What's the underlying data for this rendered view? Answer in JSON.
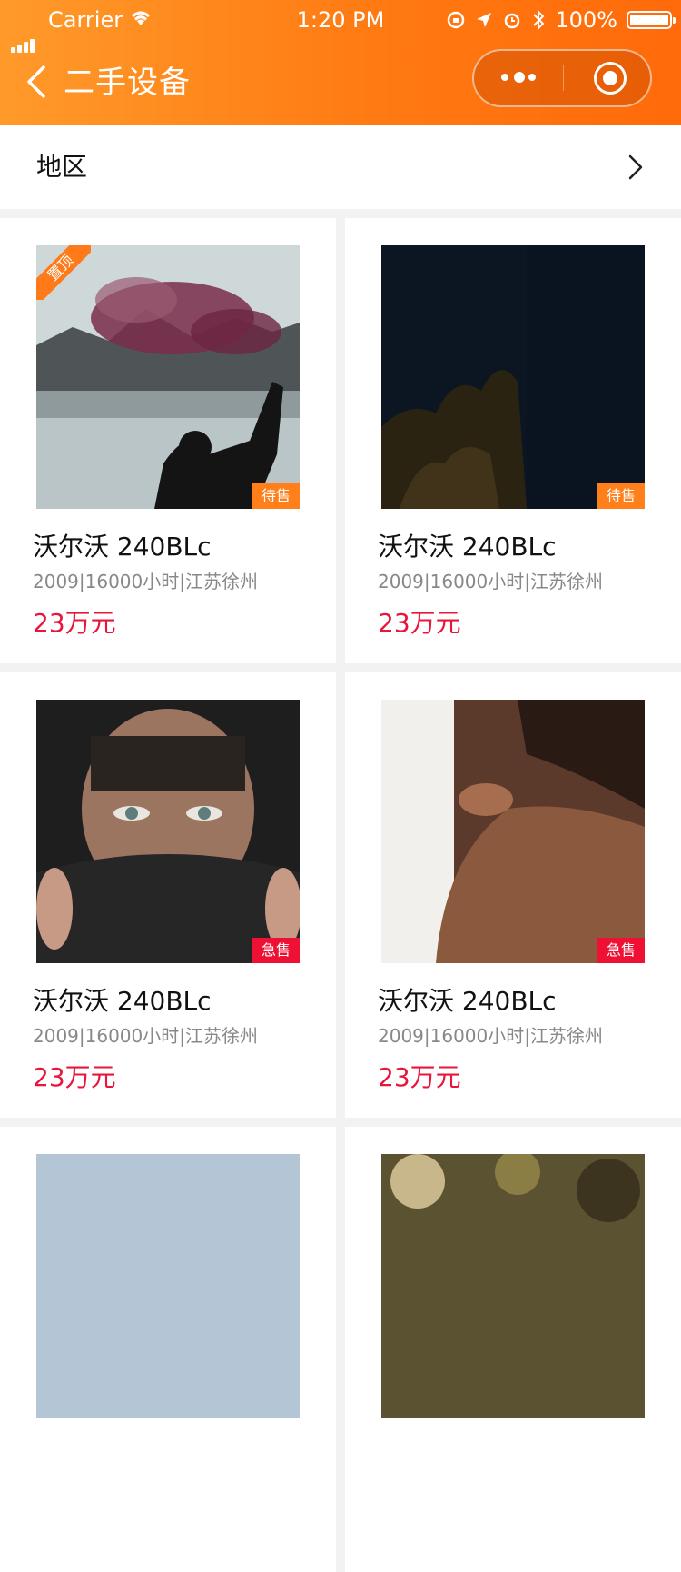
{
  "status_bar": {
    "carrier": "Carrier",
    "time": "1:20 PM",
    "battery": "100%"
  },
  "nav": {
    "title": "二手设备",
    "back_icon": "chevron-left-icon",
    "more_icon": "more-dots-icon",
    "close_icon": "target-icon"
  },
  "filter": {
    "label": "地区",
    "icon": "chevron-right-icon"
  },
  "colors": {
    "accent": "#ff7a12",
    "price": "#e8163a",
    "tag_wait": "#ff7f1a",
    "tag_urgent": "#ee1133"
  },
  "listings": [
    {
      "name": "沃尔沃 240BLc",
      "meta": "2009|16000小时|江苏徐州",
      "price": "23万元",
      "tag": "待售",
      "ribbon": "置顶",
      "image": "smoke-lake-photo"
    },
    {
      "name": "沃尔沃 240BLc",
      "meta": "2009|16000小时|江苏徐州",
      "price": "23万元",
      "tag": "待售",
      "ribbon": "",
      "image": "night-tree-photo"
    },
    {
      "name": "沃尔沃 240BLc",
      "meta": "2009|16000小时|江苏徐州",
      "price": "23万元",
      "tag": "急售",
      "ribbon": "",
      "image": "hooded-woman-photo"
    },
    {
      "name": "沃尔沃 240BLc",
      "meta": "2009|16000小时|江苏徐州",
      "price": "23万元",
      "tag": "急售",
      "ribbon": "",
      "image": "bare-shoulder-photo"
    },
    {
      "name": "",
      "meta": "",
      "price": "",
      "tag": "",
      "ribbon": "",
      "image": "sky-photo"
    },
    {
      "name": "",
      "meta": "",
      "price": "",
      "tag": "",
      "ribbon": "",
      "image": "bokeh-photo"
    }
  ]
}
